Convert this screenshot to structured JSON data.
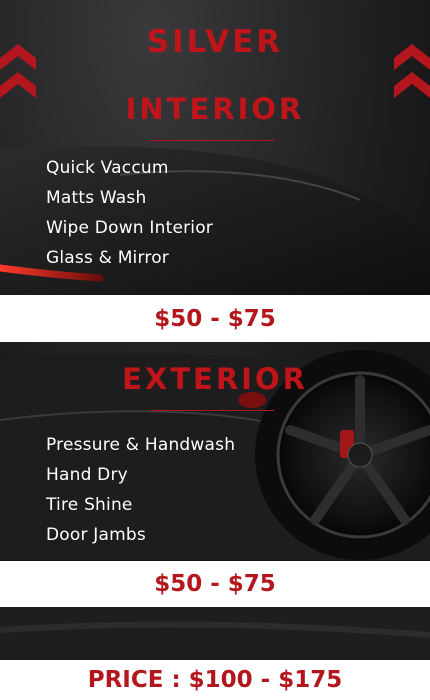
{
  "silver": {
    "title": "SILVER"
  },
  "interior": {
    "title": "INTERIOR",
    "items": [
      "Quick Vaccum",
      "Matts Wash",
      "Wipe Down Interior",
      "Glass & Mirror"
    ],
    "price": "$50 - $75"
  },
  "exterior": {
    "title": "EXTERIOR",
    "items": [
      "Pressure & Handwash",
      "Hand Dry",
      "Tire Shine",
      "Door Jambs"
    ],
    "price": "$50 - $75"
  },
  "total": {
    "label": "PRICE : $100 - $175"
  },
  "colors": {
    "accent": "#b3161c",
    "background": "#1b1b1c",
    "text": "#ffffff",
    "band": "#ffffff"
  }
}
